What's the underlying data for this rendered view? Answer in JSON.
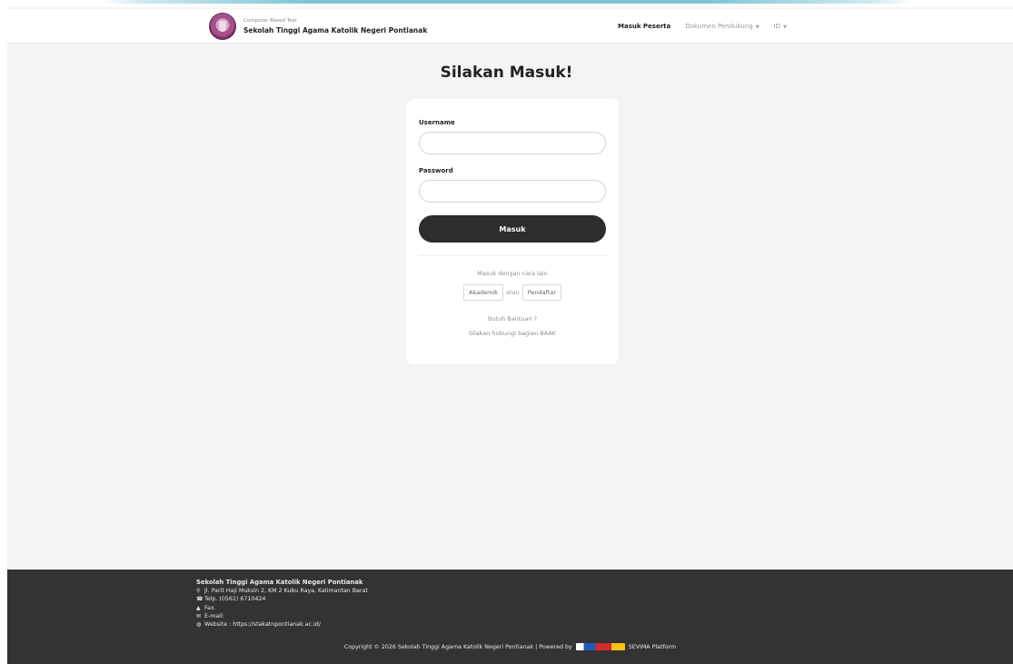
{
  "navbar": {
    "brand_subtitle": "Computer Based Test",
    "brand_title": "Sekolah Tinggi Agama Katolik Negeri Pontianak",
    "links": [
      {
        "label": "Masuk Peserta",
        "active": true
      },
      {
        "label": "Dokumen Pendukung",
        "dropdown": true
      },
      {
        "label": "ID",
        "dropdown": true
      }
    ]
  },
  "login": {
    "heading": "Silakan Masuk!",
    "username_label": "Username",
    "username_value": "",
    "password_label": "Password",
    "password_value": "",
    "submit_label": "Masuk",
    "alt_text": "Masuk dengan cara lain",
    "alt_options": [
      "Akademik",
      "Pendaftar"
    ],
    "alt_separator": "atau",
    "help_title": "Butuh Bantuan ?",
    "help_text": "Silakan hubungi bagian BAAK"
  },
  "footer": {
    "name": "Sekolah Tinggi Agama Katolik Negeri Pontianak",
    "address": "Jl. Parit Haji Muksin 2, KM 2 Kubu Raya, Kalimantan Barat",
    "phone": "Telp. (0561) 6710424",
    "fax": "Fax.",
    "email": "E-mail:",
    "website": "Website : https://stakatnpontianak.ac.id/",
    "copyright": "Copyright © 2026 Sekolah Tinggi Agama Katolik Negeri Pontianak | Powered by",
    "platform": "SEVIMA Platform"
  },
  "colors": {
    "page_bg": "#f4f4f4",
    "card_bg": "#ffffff",
    "button_bg": "#2d2d2d",
    "footer_bg": "#333333"
  },
  "icons": [
    "logo-icon",
    "caret-down-icon",
    "map-pin-icon",
    "phone-icon",
    "fax-icon",
    "mail-icon",
    "globe-icon",
    "sevima-logo"
  ]
}
